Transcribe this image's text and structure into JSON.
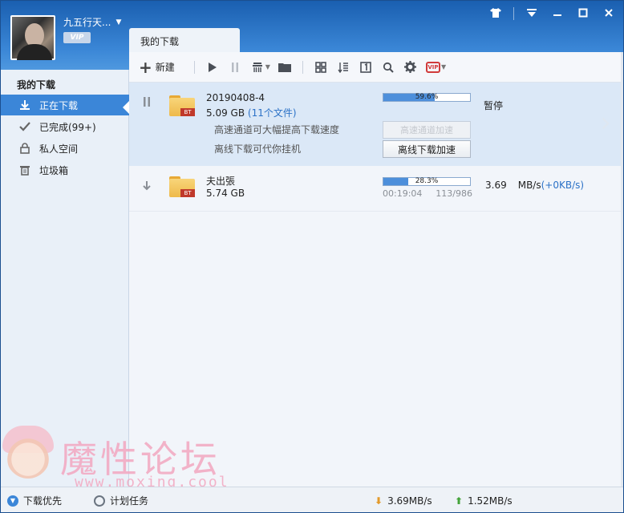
{
  "user": {
    "name": "九五行天...",
    "vip_badge": "VIP"
  },
  "window_controls": [
    "shirt-icon",
    "menu-icon",
    "minimize-icon",
    "maximize-icon",
    "close-icon"
  ],
  "tab": {
    "label": "我的下载"
  },
  "sidebar": {
    "title": "我的下载",
    "items": [
      {
        "label": "正在下载",
        "icon": "download-icon",
        "active": true
      },
      {
        "label": "已完成(99+)",
        "icon": "check-icon",
        "active": false
      },
      {
        "label": "私人空间",
        "icon": "lock-icon",
        "active": false
      },
      {
        "label": "垃圾箱",
        "icon": "trash-icon",
        "active": false
      }
    ]
  },
  "toolbar": {
    "new_label": "新建"
  },
  "tasks": [
    {
      "name": "20190408-4",
      "size": "5.09 GB",
      "files": "(11个文件)",
      "progress_text": "59.6%",
      "progress": 0.596,
      "state_text": "暂停",
      "hint1": "高速通道可大幅提高下载速度",
      "hint2": "离线下载可代你挂机",
      "accel_label": "高速通道加速",
      "offline_label": "离线下载加速",
      "badge": "BT"
    },
    {
      "name": "夫出張",
      "size": "5.74 GB",
      "progress_text": "28.3%",
      "progress": 0.283,
      "elapsed": "00:19:04",
      "pieces": "113/986",
      "speed_value": "3.69",
      "speed_unit": "MB/s",
      "speed_extra": "(+0KB/s)",
      "badge": "BT"
    }
  ],
  "watermark": {
    "text": "魔性论坛",
    "url": "www.moxing.cool"
  },
  "statusbar": {
    "priority_label": "下载优先",
    "plan_label": "计划任务",
    "down_speed": "3.69MB/s",
    "up_speed": "1.52MB/s"
  }
}
